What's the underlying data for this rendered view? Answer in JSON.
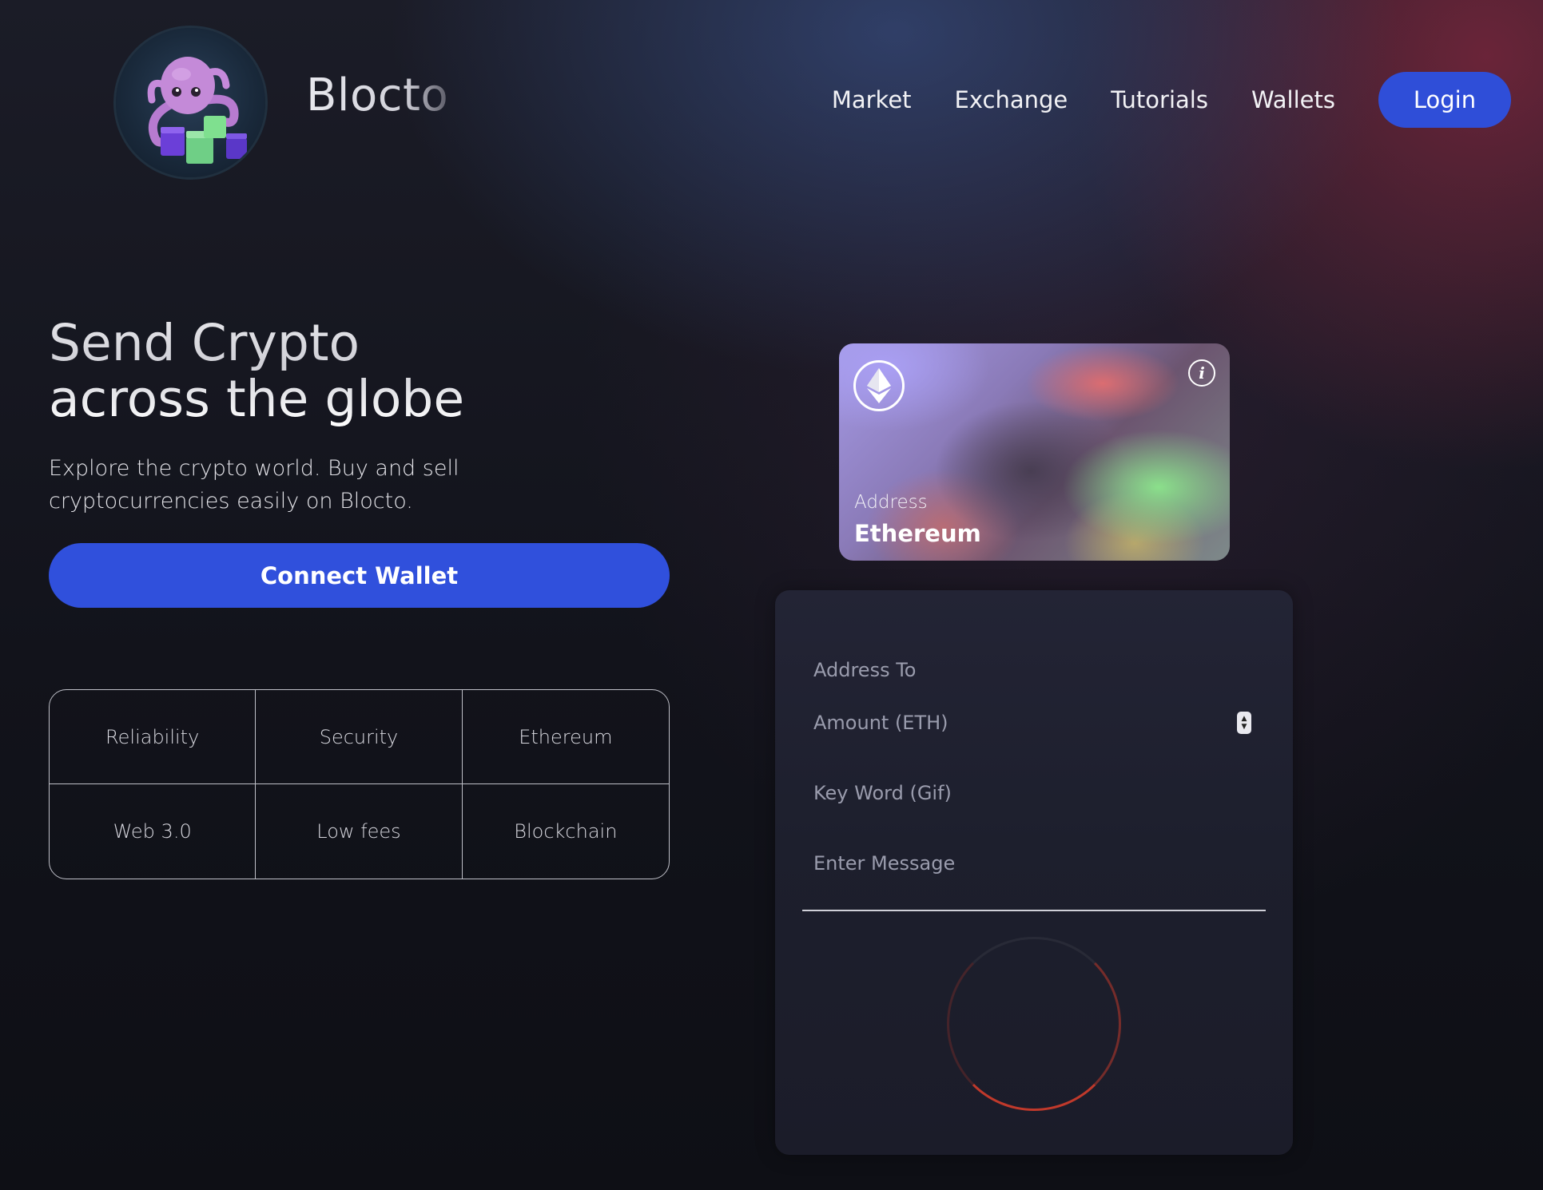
{
  "header": {
    "brand": "Blocto",
    "nav": [
      "Market",
      "Exchange",
      "Tutorials",
      "Wallets"
    ],
    "login_label": "Login"
  },
  "hero": {
    "title_line1": "Send Crypto",
    "title_line2": "across the globe",
    "subtitle": "Explore the crypto world. Buy and sell cryptocurrencies easily on Blocto.",
    "connect_label": "Connect Wallet"
  },
  "features": [
    "Reliability",
    "Security",
    "Ethereum",
    "Web 3.0",
    "Low fees",
    "Blockchain"
  ],
  "card": {
    "address_label": "Address",
    "network": "Ethereum",
    "icons": [
      "ethereum-icon",
      "info-icon"
    ]
  },
  "form": {
    "address_to_placeholder": "Address To",
    "amount_placeholder": "Amount (ETH)",
    "keyword_placeholder": "Key Word (Gif)",
    "message_placeholder": "Enter Message"
  },
  "colors": {
    "accent": "#3050dc",
    "loader": "#c0392b",
    "background": "#0d0e14"
  }
}
